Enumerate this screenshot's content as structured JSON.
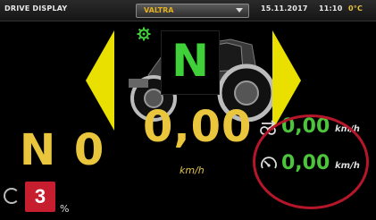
{
  "topbar": {
    "title": "DRIVE DISPLAY",
    "profile_value": "VALTRA",
    "date": "15.11.2017",
    "time": "11:10",
    "temperature": "0°C"
  },
  "gear": {
    "direction": "N",
    "range": "N 0"
  },
  "speed": {
    "main_value": "0,00",
    "main_unit": "km/h",
    "slip_speed_value": "0,00",
    "slip_speed_unit": "km/h",
    "ground_speed_value": "0,00",
    "ground_speed_unit": "km/h"
  },
  "bottom": {
    "badge_number": "3",
    "percent_label": "%"
  },
  "icons": {
    "settings": "gear-settings-icon",
    "slip": "wheel-slip-icon",
    "gauge": "speedometer-icon",
    "left_arrow": "arrow-left-icon",
    "right_arrow": "arrow-right-icon"
  },
  "colors": {
    "accent_yellow": "#e9c63c",
    "arrow_yellow": "#e9e000",
    "gear_green": "#3fd03a",
    "speed_green": "#4cc43c",
    "badge_red": "#c61e2e",
    "circle_red": "#b5162a"
  }
}
